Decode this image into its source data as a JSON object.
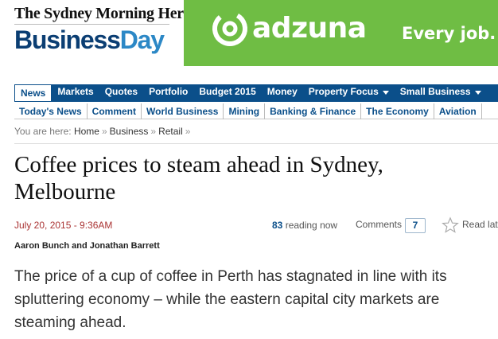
{
  "masthead": {
    "smh": "The Sydney Morning Herald",
    "bd_part1": "Business",
    "bd_part2": "Day"
  },
  "ad": {
    "brand": "adzuna",
    "tagline": "Every job. Ev"
  },
  "nav_primary": [
    {
      "label": "News",
      "active": true,
      "dropdown": false
    },
    {
      "label": "Markets",
      "active": false,
      "dropdown": false
    },
    {
      "label": "Quotes",
      "active": false,
      "dropdown": false
    },
    {
      "label": "Portfolio",
      "active": false,
      "dropdown": false
    },
    {
      "label": "Budget 2015",
      "active": false,
      "dropdown": false
    },
    {
      "label": "Money",
      "active": false,
      "dropdown": false
    },
    {
      "label": "Property Focus",
      "active": false,
      "dropdown": true
    },
    {
      "label": "Small Business",
      "active": false,
      "dropdown": true
    }
  ],
  "nav_secondary": [
    "Today's News",
    "Comment",
    "World Business",
    "Mining",
    "Banking & Finance",
    "The Economy",
    "Aviation"
  ],
  "breadcrumb": {
    "prefix": "You are here:",
    "items": [
      "Home",
      "Business",
      "Retail"
    ],
    "sep": "»"
  },
  "article": {
    "headline": "Coffee prices to steam ahead in Sydney, Melbourne",
    "date": "July 20, 2015 - 9:36AM",
    "reading_count": "83",
    "reading_label": "reading now",
    "comments_label": "Comments",
    "comments_count": "7",
    "read_later_label": "Read lat",
    "byline": "Aaron Bunch and Jonathan Barrett",
    "intro": "The price of a cup of coffee in Perth has stagnated in line with its spluttering economy – while the eastern capital city markets are steaming ahead."
  },
  "colors": {
    "nav_blue": "#0b4f8a",
    "ad_green": "#6fbd44",
    "date_red": "#a33333"
  }
}
